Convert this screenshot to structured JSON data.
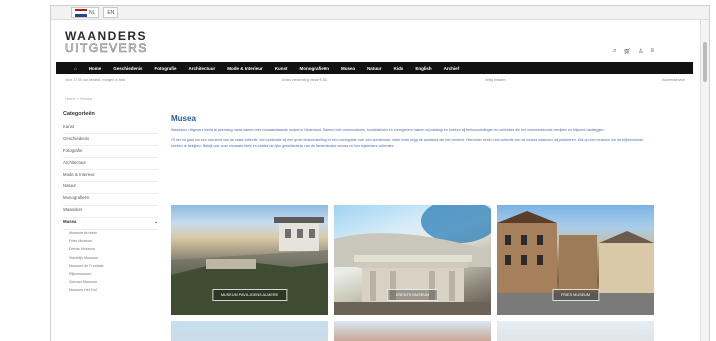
{
  "browser": {
    "tab_text": "NL",
    "tab2_text": "EN"
  },
  "brand": {
    "line1": "WAANDERS",
    "line2": "UITGEVERS"
  },
  "header_icons": [
    "search-icon",
    "cart-icon",
    "user-icon",
    "menu-icon"
  ],
  "nav": [
    "Home",
    "Geschiedenis",
    "Fotografie",
    "Architectuur",
    "Mode & Interieur",
    "Kunst",
    "Monografieën",
    "Musea",
    "Natuur",
    "Kids",
    "English",
    "Archief"
  ],
  "usp": [
    "Voor 17.00 uur besteld, morgen in huis",
    "Gratis verzending vanaf € 35,-",
    "Veilig betalen",
    "Klantenservice"
  ],
  "breadcrumb": "Home > Musea",
  "sidebar": {
    "title": "Categorieën",
    "categories": [
      "Kunst",
      "Geschiedenis",
      "Fotografie",
      "Architectuur",
      "Mode & Interieur",
      "Natuur",
      "Monografieën",
      "Waanders",
      "Musea"
    ],
    "subs": [
      "Museum Arnhem",
      "Fries Museum",
      "Drents Museum",
      "Stedelijk Museum",
      "Museum de Fundatie",
      "Rijksmuseum",
      "Zeeuws Museum",
      "Museum Het Hof"
    ]
  },
  "main": {
    "title": "Musea",
    "para1": "Waanders Uitgevers werkt al jarenlang nauw samen met vooraanstaande musea in Nederland. Samen met conservatoren, kunsthistorici en vormgevers maken wij catalogi en boeken bij tentoonstellingen en collecties die het museumbezoek verrijken en blijvend vastleggen.",
    "para2": "Of het nu gaat om een overzicht van de vaste collectie, een publicatie bij een grote tentoonstelling of een monografie over een kunstenaar: ieder boek krijgt de aandacht die het verdient. Hieronder vindt u een selectie van de musea waarvoor wij publiceren. Klik op een museum om de bijbehorende boeken te bekijken. Bekijk ook onze nieuwste titels en ontdek de rijke geschiedenis van de Nederlandse musea en hun bijzondere collecties."
  },
  "cards": [
    "MUSEUM PAVILJOENS ALMERE",
    "DRENTS MUSEUM",
    "FRIES MUSEUM"
  ]
}
